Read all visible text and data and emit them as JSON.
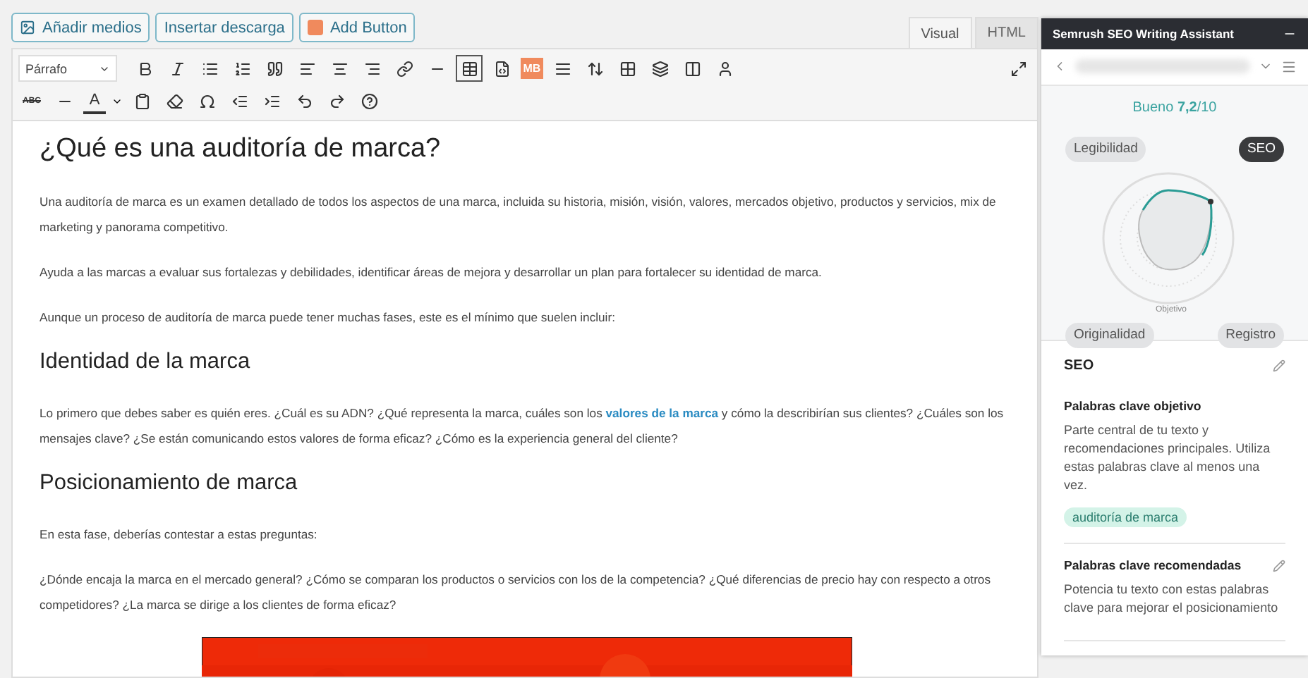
{
  "media_buttons": [
    {
      "label": "Añadir medios",
      "kind": "media"
    },
    {
      "label": "Insertar descarga",
      "kind": "plain"
    },
    {
      "label": "Add Button",
      "kind": "addon"
    }
  ],
  "tabs": [
    {
      "label": "Visual",
      "selected": true
    },
    {
      "label": "HTML",
      "selected": false
    }
  ],
  "toolbar": {
    "format": "Párrafo",
    "mb_label": "MB",
    "strike_label": "ABC",
    "color_label": "A"
  },
  "content": [
    {
      "kind": "h2",
      "text": "¿Qué es una auditoría de marca?"
    },
    {
      "kind": "p",
      "text": "Una auditoría de marca es un examen detallado de todos los aspectos de una marca, incluida su historia, misión, visión, valores, mercados objetivo, productos y servicios, mix de marketing y panorama competitivo."
    },
    {
      "kind": "p",
      "text": "Ayuda a las marcas a evaluar sus fortalezas y debilidades, identificar áreas de mejora y desarrollar un plan para fortalecer su identidad de marca."
    },
    {
      "kind": "p",
      "text": "Aunque un proceso de auditoría de marca puede tener muchas fases, este es el mínimo que suelen incluir:"
    },
    {
      "kind": "h3",
      "text": "Identidad de la marca"
    },
    {
      "kind": "p",
      "text": "Lo primero que debes saber es quién eres. ¿Cuál es su ADN? ¿Qué representa la marca, cuáles son los ",
      "link": "valores de la marca",
      "after": " y cómo la describirían sus clientes? ¿Cuáles son los mensajes clave? ¿Se están comunicando estos valores de forma eficaz? ¿Cómo es la experiencia general del cliente?"
    },
    {
      "kind": "h3",
      "text": "Posicionamiento de marca"
    },
    {
      "kind": "p",
      "text": "En esta fase, deberías contestar a estas preguntas:"
    },
    {
      "kind": "p",
      "text": "¿Dónde encaja la marca en el mercado general? ¿Cómo se comparan los productos o servicios con los de la competencia? ¿Qué diferencias de precio hay con respecto a otros competidores? ¿La marca se dirige a los clientes de forma eficaz?"
    },
    {
      "kind": "picture"
    }
  ],
  "assistant": {
    "title": "Semrush SEO Writing Assistant",
    "score_label": "Bueno",
    "score": "7,2",
    "score_max": "/10",
    "target_label": "Objetivo",
    "metrics": [
      {
        "label": "Legibilidad",
        "selected": false
      },
      {
        "label": "SEO",
        "selected": true
      },
      {
        "label": "Originalidad",
        "selected": false
      },
      {
        "label": "Registro",
        "selected": false
      }
    ],
    "section_title": "SEO",
    "blocks": [
      {
        "title": "Palabras clave objetivo",
        "text": "Parte central de tu texto y recomendaciones principales. Utiliza estas palabras clave al menos una vez.",
        "keywords": [
          "auditoría de marca"
        ],
        "editable": false
      },
      {
        "title": "Palabras clave recomendadas",
        "text": "Potencia tu texto con estas palabras clave para mejorar el posicionamiento",
        "editable": true
      }
    ]
  }
}
